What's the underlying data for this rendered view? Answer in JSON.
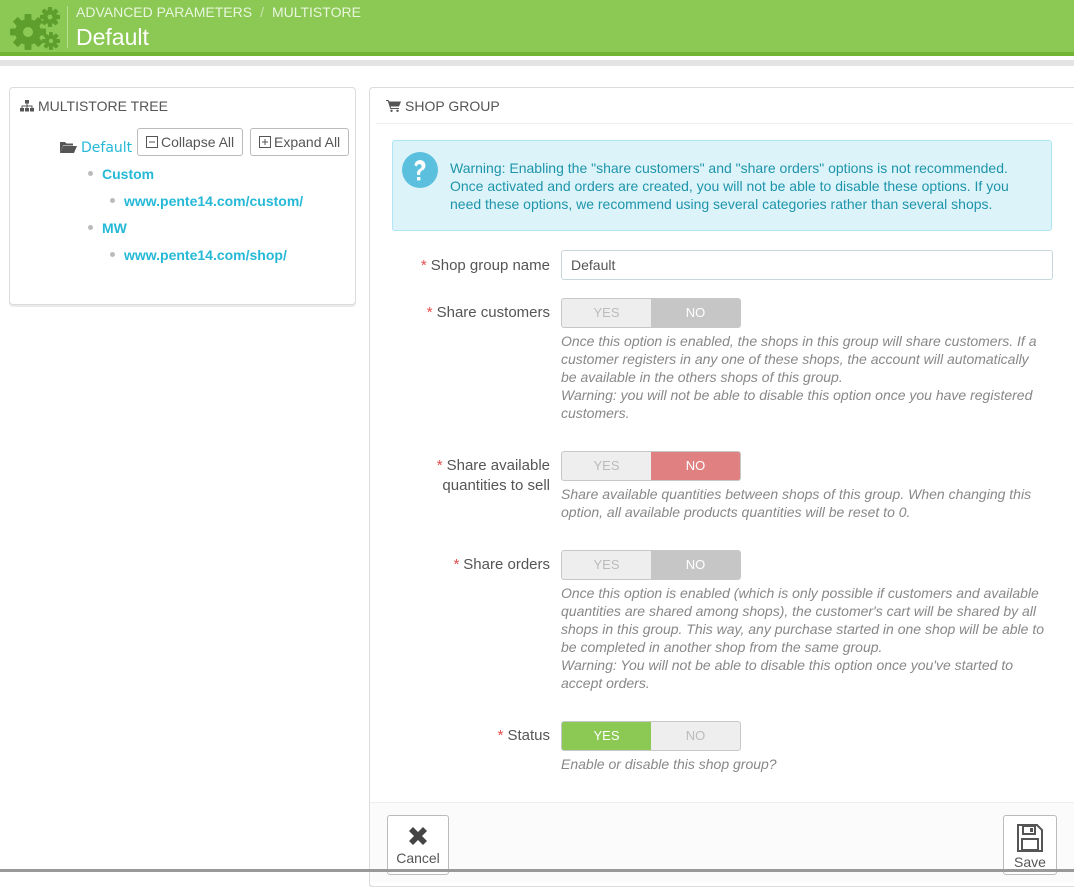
{
  "header": {
    "icon": "gears-icon",
    "breadcrumb": [
      "ADVANCED PARAMETERS",
      "MULTISTORE"
    ],
    "separator": "/",
    "title": "Default"
  },
  "tree_panel": {
    "heading": "MULTISTORE TREE",
    "heading_icon": "sitemap-icon",
    "root": "Default",
    "root_icon": "folder-open-icon",
    "collapse_label": "Collapse All",
    "expand_label": "Expand All",
    "items": [
      {
        "label": "Custom",
        "children": [
          "www.pente14.com/custom/"
        ]
      },
      {
        "label": "MW",
        "children": [
          "www.pente14.com/shop/"
        ]
      }
    ]
  },
  "form_panel": {
    "heading": "SHOP GROUP",
    "heading_icon": "shopping-cart-icon",
    "alert": {
      "icon": "question-circle-icon",
      "lines": [
        "Warning: Enabling the \"share customers\" and \"share orders\" options is not recommended.",
        "Once activated and orders are created, you will not be able to disable these options. If you",
        "need these options, we recommend using several categories rather than several shops."
      ]
    },
    "required_mark": "*",
    "fields": {
      "name": {
        "label": "Shop group name",
        "value": "Default"
      },
      "share_customers": {
        "label": "Share customers",
        "yes": "YES",
        "no": "NO",
        "selected": "NO",
        "help": [
          "Once this option is enabled, the shops in this group will share customers. If a",
          "customer registers in any one of these shops, the account will automatically",
          "be available in the others shops of this group.",
          "Warning: you will not be able to disable this option once you have registered",
          "customers."
        ]
      },
      "share_stock": {
        "label_line1": "Share available",
        "label_line2": "quantities to sell",
        "yes": "YES",
        "no": "NO",
        "selected": "NO",
        "help": [
          "Share available quantities between shops of this group. When changing this",
          "option, all available products quantities will be reset to 0."
        ]
      },
      "share_orders": {
        "label": "Share orders",
        "yes": "YES",
        "no": "NO",
        "selected": "NO",
        "help": [
          "Once this option is enabled (which is only possible if customers and available",
          "quantities are shared among shops), the customer's cart will be shared by all",
          "shops in this group. This way, any purchase started in one shop will be able to",
          "be completed in another shop from the same group.",
          "Warning: You will not be able to disable this option once you've started to",
          "accept orders."
        ]
      },
      "status": {
        "label": "Status",
        "yes": "YES",
        "no": "NO",
        "selected": "YES",
        "help": [
          "Enable or disable this shop group?"
        ]
      }
    },
    "footer": {
      "cancel_label": "Cancel",
      "cancel_icon": "close-icon",
      "save_label": "Save",
      "save_icon": "floppy-disk-icon"
    }
  },
  "colors": {
    "header_green": "#8bc954",
    "link_blue": "#25b9d7",
    "alert_bg": "#dcf4f9",
    "required_red": "#e64c4c",
    "no_red": "#e08080"
  }
}
